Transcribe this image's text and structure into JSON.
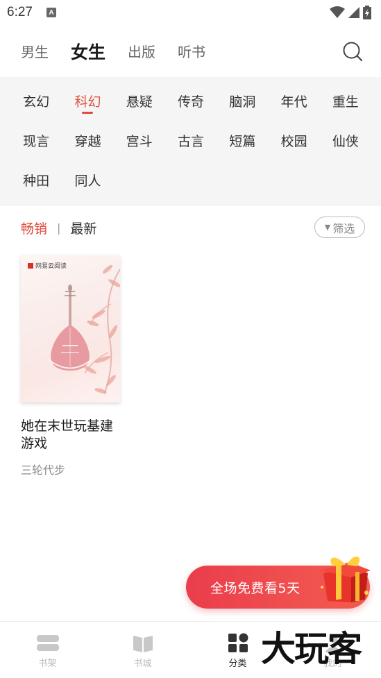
{
  "status": {
    "time": "6:27",
    "notif_icon": "A"
  },
  "topnav": {
    "tabs": [
      {
        "label": "男生",
        "active": false
      },
      {
        "label": "女生",
        "active": true
      },
      {
        "label": "出版",
        "active": false
      },
      {
        "label": "听书",
        "active": false
      }
    ],
    "search_icon": "search-icon"
  },
  "genres": {
    "row1": [
      "玄幻",
      "科幻",
      "悬疑",
      "传奇",
      "脑洞",
      "年代",
      "重生"
    ],
    "row2": [
      "现言",
      "穿越",
      "宫斗",
      "古言",
      "短篇",
      "校园",
      "仙侠"
    ],
    "row3": [
      "种田",
      "同人"
    ],
    "active": "科幻"
  },
  "sort": {
    "hot": "畅销",
    "new": "最新",
    "filter": "筛选"
  },
  "books": [
    {
      "title": "她在末世玩基建游戏",
      "author": "三轮代步",
      "cover_logo": "网易云阅读"
    }
  ],
  "promo": {
    "text": "全场免费看5天"
  },
  "bottombar": {
    "tabs": [
      {
        "label": "书架",
        "icon": "bookshelf-icon"
      },
      {
        "label": "书城",
        "icon": "book-icon"
      },
      {
        "label": "分类",
        "icon": "category-icon"
      },
      {
        "label": "我的",
        "icon": "profile-icon"
      }
    ]
  },
  "watermark": "大玩客",
  "colors": {
    "accent": "#e14b3b",
    "promo": "#ef4a4e"
  }
}
